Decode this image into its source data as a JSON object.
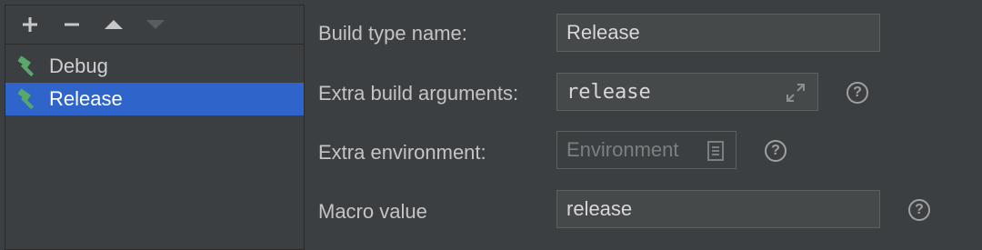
{
  "toolbar": {
    "add_icon": "plus-icon",
    "remove_icon": "minus-icon",
    "up_icon": "arrow-up-icon",
    "down_icon": "arrow-down-icon"
  },
  "build_types": [
    {
      "label": "Debug",
      "icon": "hammer-icon",
      "selected": false
    },
    {
      "label": "Release",
      "icon": "hammer-icon",
      "selected": true
    }
  ],
  "form": {
    "build_type_name_label": "Build type name:",
    "build_type_name_value": "Release",
    "extra_build_args_label": "Extra build arguments:",
    "extra_build_args_value": "release",
    "extra_env_label": "Extra environment:",
    "extra_env_placeholder": "Environment",
    "macro_value_label": "Macro value",
    "macro_value_value": "release",
    "help_glyph": "?"
  },
  "colors": {
    "background": "#3c3f41",
    "selection": "#2f65ca",
    "hammer": "#59a869"
  }
}
